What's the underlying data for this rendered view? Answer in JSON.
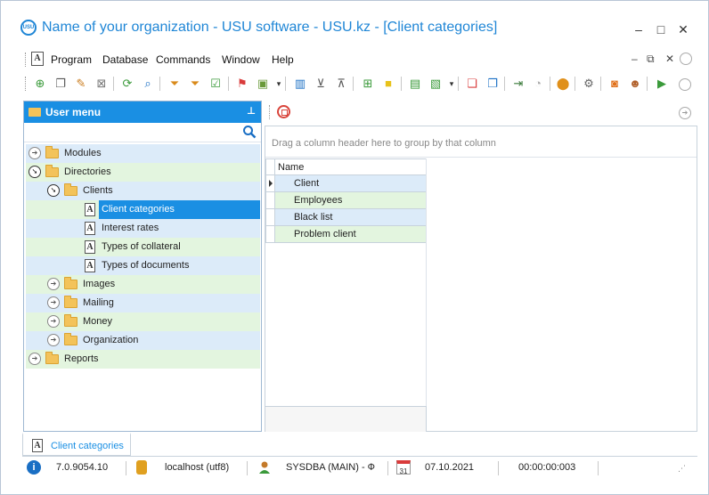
{
  "window": {
    "title": "Name of your organization - USU software - USU.kz - [Client categories]",
    "logo_text": "USU",
    "controls": [
      "–",
      "□",
      "✕"
    ]
  },
  "menubar": {
    "items": [
      "Program",
      "Database",
      "Commands",
      "Window",
      "Help"
    ],
    "doc_glyph": "A",
    "mdi_controls": [
      "–",
      "⧉",
      "✕"
    ]
  },
  "left_panel": {
    "header": "User menu",
    "pin": "⊥",
    "tree": [
      {
        "label": "Modules"
      },
      {
        "label": "Directories"
      },
      {
        "label": "Clients"
      },
      {
        "label": "Client categories"
      },
      {
        "label": "Interest rates"
      },
      {
        "label": "Types of collateral"
      },
      {
        "label": "Types of documents"
      },
      {
        "label": "Images"
      },
      {
        "label": "Mailing"
      },
      {
        "label": "Money"
      },
      {
        "label": "Organization"
      },
      {
        "label": "Reports"
      }
    ]
  },
  "grid": {
    "group_hint": "Drag a column header here to group by that column",
    "column_header": "Name",
    "rows": [
      "Client",
      "Employees",
      "Black list",
      "Problem client"
    ]
  },
  "bottom_tab": {
    "label": "Client categories"
  },
  "status_bar": {
    "version": "7.0.9054.10",
    "server": "localhost (utf8)",
    "user": "SYSDBA (MAIN) - Ф",
    "date": "07.10.2021",
    "timer": "00:00:00:003",
    "calendar_day": "31"
  },
  "colors": {
    "accent": "#1a8fe3",
    "title": "#1f86d6",
    "row_blue": "#dcebf9",
    "row_green": "#e3f5df",
    "folder": "#f3c35a"
  }
}
